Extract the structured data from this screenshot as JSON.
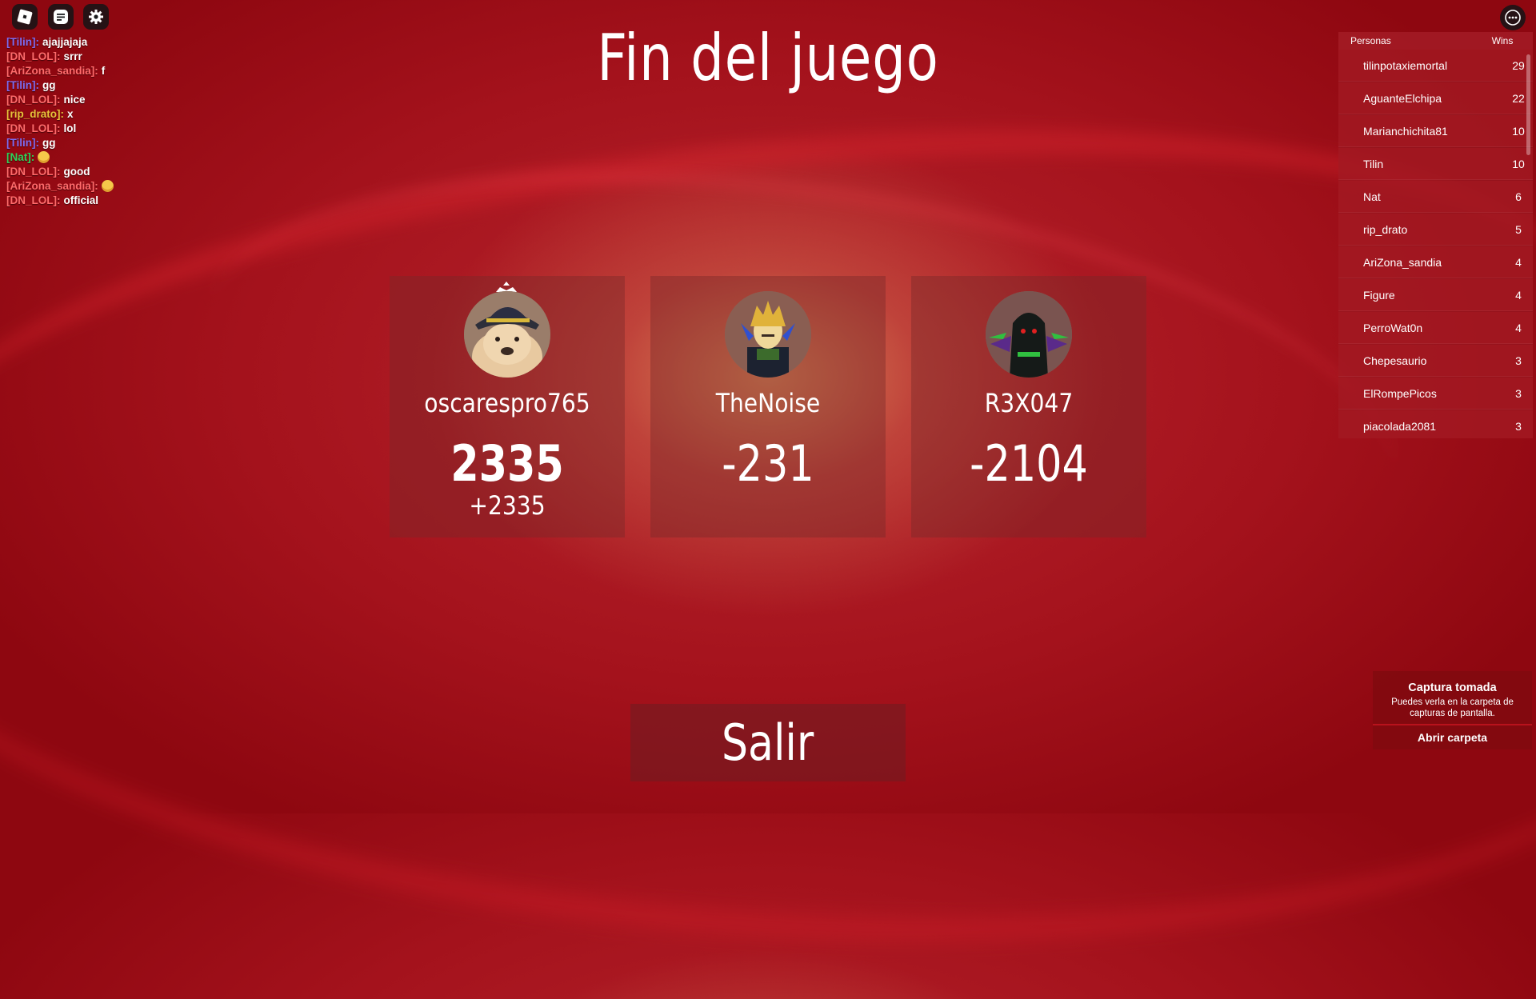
{
  "title": "Fin del juego",
  "chat": [
    {
      "name": "[Tilin]:",
      "color": "#7c6cf0",
      "msg": "ajajjajaja"
    },
    {
      "name": "[DN_LOL]:",
      "color": "#ff6b6b",
      "msg": "srrr"
    },
    {
      "name": "[AriZona_sandia]:",
      "color": "#ff6b6b",
      "msg": "f"
    },
    {
      "name": "[Tilin]:",
      "color": "#7c6cf0",
      "msg": "gg"
    },
    {
      "name": "[DN_LOL]:",
      "color": "#ff6b6b",
      "msg": "nice"
    },
    {
      "name": "[rip_drato]:",
      "color": "#e8c33a",
      "msg": "x"
    },
    {
      "name": "[DN_LOL]:",
      "color": "#ff6b6b",
      "msg": "lol"
    },
    {
      "name": "[Tilin]:",
      "color": "#7c6cf0",
      "msg": "gg"
    },
    {
      "name": "[Nat]:",
      "color": "#2ed35a",
      "msg": "",
      "emoji": "grinning-sweat-emoji"
    },
    {
      "name": "[DN_LOL]:",
      "color": "#ff6b6b",
      "msg": "good"
    },
    {
      "name": "[AriZona_sandia]:",
      "color": "#ff6b6b",
      "msg": "",
      "emoji": "grinning-sweat-emoji"
    },
    {
      "name": "[DN_LOL]:",
      "color": "#ff6b6b",
      "msg": "official"
    }
  ],
  "players": [
    {
      "name": "oscarespro765",
      "score": "2335",
      "delta": "+2335",
      "winner": true
    },
    {
      "name": "TheNoise",
      "score": "-231",
      "delta": "",
      "winner": false
    },
    {
      "name": "R3X047",
      "score": "-2104",
      "delta": "",
      "winner": false
    }
  ],
  "exit_label": "Salir",
  "leaderboard": {
    "col_name": "Personas",
    "col_wins": "Wins",
    "rows": [
      {
        "name": "tilinpotaxiemortal",
        "wins": "29"
      },
      {
        "name": "AguanteElchipa",
        "wins": "22"
      },
      {
        "name": "Marianchichita81",
        "wins": "10"
      },
      {
        "name": "Tilin",
        "wins": "10"
      },
      {
        "name": "Nat",
        "wins": "6"
      },
      {
        "name": "rip_drato",
        "wins": "5"
      },
      {
        "name": "AriZona_sandia",
        "wins": "4"
      },
      {
        "name": "Figure",
        "wins": "4"
      },
      {
        "name": "PerroWat0n",
        "wins": "4"
      },
      {
        "name": "Chepesaurio",
        "wins": "3"
      },
      {
        "name": "ElRompePicos",
        "wins": "3"
      },
      {
        "name": "piacolada2081",
        "wins": "3"
      }
    ]
  },
  "toast": {
    "title": "Captura tomada",
    "body": "Puedes verla en la carpeta de capturas de pantalla.",
    "button": "Abrir carpeta"
  },
  "icons": {
    "roblox": "roblox-logo-icon",
    "chat": "chat-icon",
    "settings": "gear-icon",
    "menu": "more-options-icon",
    "crown": "crown-icon"
  }
}
